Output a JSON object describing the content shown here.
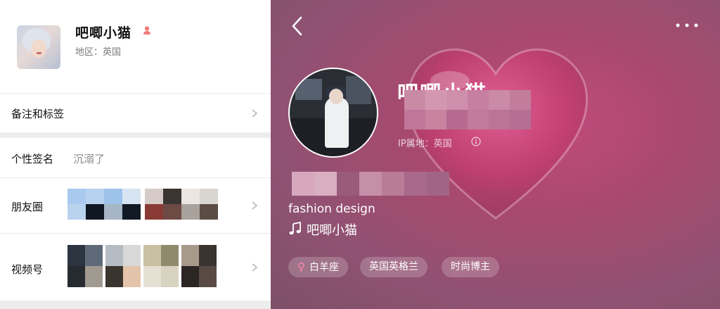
{
  "contact": {
    "name": "吧唧小猫",
    "region": "地区：英国",
    "remark_label": "备注和标签",
    "signature_label": "个性签名",
    "signature_value": "沉溺了",
    "moments_label": "朋友圈",
    "channels_label": "视频号"
  },
  "profile": {
    "name": "吧唧小猫",
    "ip_region": "IP属地：英国",
    "bio": "fashion design",
    "music": "吧唧小猫",
    "tags": [
      {
        "label": "白羊座",
        "icon": "female-icon"
      },
      {
        "label": "英国英格兰"
      },
      {
        "label": "时尚博主"
      }
    ]
  },
  "colors": {
    "profile_bg": "#a8496f",
    "heart": "#c8396e",
    "female_accent": "#ff86a8"
  }
}
